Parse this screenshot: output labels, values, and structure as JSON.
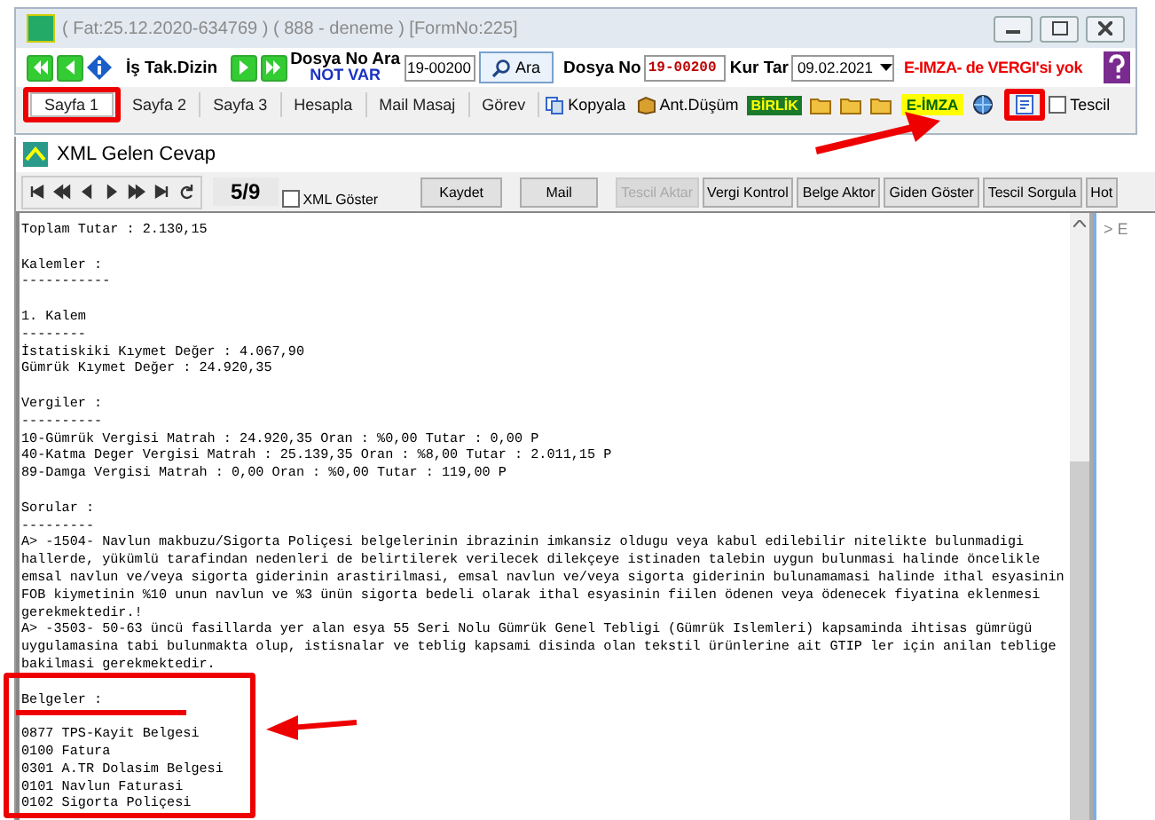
{
  "window": {
    "title": "( Fat:25.12.2020-634769 ) ( 888 - deneme ) [FormNo:225]"
  },
  "toolbar": {
    "dizin_label": "İş Tak.Dizin",
    "search_label": "Dosya No Ara",
    "search_note": "NOT VAR",
    "search_value": "19-00200",
    "search_button": "Ara",
    "file_label": "Dosya No",
    "file_value": "19-00200",
    "rate_label": "Kur Tar",
    "rate_date": "09.02.2021",
    "warning": "E-IMZA- de VERGI'si yok"
  },
  "tabs": [
    {
      "label": "Sayfa 1",
      "selected": true
    },
    {
      "label": "Sayfa 2",
      "selected": false
    },
    {
      "label": "Sayfa 3",
      "selected": false
    },
    {
      "label": "Hesapla",
      "selected": false
    },
    {
      "label": "Mail Masaj",
      "selected": false
    },
    {
      "label": "Görev",
      "selected": false
    }
  ],
  "tools": [
    {
      "kind": "copy",
      "label": "Kopyala"
    },
    {
      "kind": "box",
      "label": "Ant.Düşüm"
    },
    {
      "kind": "badge",
      "label": "BİRLİK"
    },
    {
      "kind": "folder"
    },
    {
      "kind": "folder"
    },
    {
      "kind": "folder"
    },
    {
      "kind": "sign",
      "label": "E-İMZA"
    },
    {
      "kind": "globe"
    },
    {
      "kind": "doc"
    }
  ],
  "tescil": {
    "label": "Tescil",
    "checked": false
  },
  "xml_window": {
    "title": "XML Gelen Cevap",
    "counter": "5/9",
    "xml_toggle": {
      "label": "XML Göster",
      "checked": false
    },
    "buttons": [
      {
        "label": "Kaydet",
        "disabled": false
      },
      {
        "label": "Mail",
        "disabled": false
      },
      {
        "label": "Tescil Aktar",
        "disabled": true
      },
      {
        "label": "Vergi Kontrol",
        "disabled": false
      },
      {
        "label": "Belge Aktor",
        "disabled": false
      },
      {
        "label": "Giden Göster",
        "disabled": false
      },
      {
        "label": "Tescil Sorgula",
        "disabled": false
      },
      {
        "label": "Hot",
        "disabled": false
      }
    ],
    "text_blocks": [
      [
        "Toplam Tutar : 2.130,15"
      ],
      [
        "Kalemler :",
        "-----------"
      ],
      [
        "1. Kalem",
        "--------",
        "İstatiskiki Kıymet Değer : 4.067,90",
        "Gümrük Kıymet Değer : 24.920,35"
      ],
      [
        "Vergiler :",
        "----------",
        "10-Gümrük Vergisi Matrah : 24.920,35 Oran : %0,00 Tutar : 0,00 P",
        "40-Katma Deger Vergisi Matrah : 25.139,35 Oran : %8,00 Tutar : 2.011,15 P",
        "89-Damga Vergisi Matrah : 0,00 Oran : %0,00 Tutar : 119,00 P"
      ],
      [
        "Sorular :",
        "---------",
        "A> -1504- Navlun makbuzu/Sigorta Poliçesi belgelerinin ibrazinin imkansiz oldugu veya kabul edilebilir nitelikte bulunmadigi",
        "hallerde, yükümlü tarafindan nedenleri de belirtilerek verilecek dilekçeye istinaden talebin uygun bulunmasi halinde öncelikle",
        "emsal navlun ve/veya sigorta giderinin arastirilmasi, emsal navlun ve/veya sigorta giderinin bulunamamasi halinde ithal esyasinin",
        "FOB kiymetinin %10 unun navlun ve %3 ünün sigorta bedeli olarak ithal esyasinin fiilen ödenen veya ödenecek fiyatina eklenmesi",
        "gerekmektedir.!",
        "A> -3503- 50-63 üncü fasillarda yer alan esya 55 Seri Nolu Gümrük Genel Tebligi (Gümrük Islemleri) kapsaminda ihtisas gümrügü",
        "uygulamasina tabi bulunmakta olup, istisnalar ve teblig kapsami disinda olan tekstil ürünlerine ait GTIP ler için anilan teblige",
        "bakilmasi gerekmektedir."
      ],
      [
        "Belgeler :"
      ],
      [
        "0877 TPS-Kayit Belgesi",
        "0100 Fatura",
        "0301 A.TR Dolasim Belgesi",
        "0101 Navlun Faturasi",
        "0102 Sigorta Poliçesi"
      ]
    ],
    "side_text": "> E"
  }
}
